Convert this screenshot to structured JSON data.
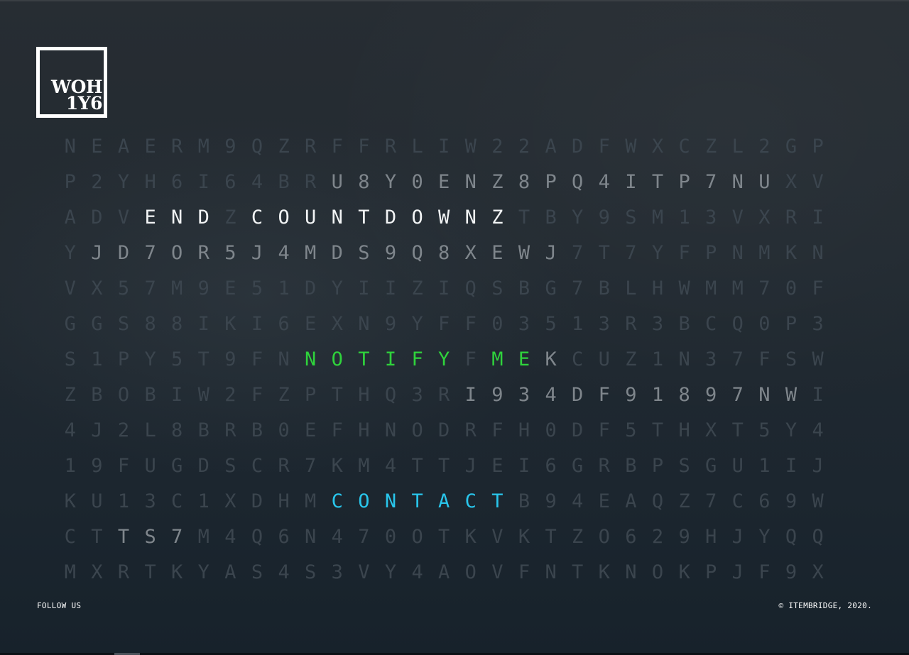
{
  "logo": {
    "line1": "WOH",
    "line2": "1Y6"
  },
  "grid_rows": [
    {
      "text": "NEAERM9QZRFFRLIW22ADFWXCZL2GP",
      "styles": "ddddddddddddddddddddddddddddd"
    },
    {
      "text": "P2YH6I64BRU8Y0ENZ8PQ4ITP7NUXV",
      "styles": "ddddddddddmmmmmmmmmmmmmmmmmdd"
    },
    {
      "text": "ADVENDZCOUNTDOWNZTBY9SM13VXRI",
      "styles": "dddtttdttttttttttdddddddddddd"
    },
    {
      "text": "YJD7OR5J4MDS9Q8XEWJ7T7YFPNMKN",
      "styles": "dmmmmmmmmmmmmmmmmmmdddddddddd"
    },
    {
      "text": "VX57M9E51DYIIZIQSBG7BLHWMM70F",
      "styles": "ddddddddddddddddddddddddddddd"
    },
    {
      "text": "GGS88IKI6EXN9YFF0351 3R3BCQ0P3",
      "styles": "ddddddddddddddddddddddddddddd"
    },
    {
      "text": "S1PY5T9FNNOTIFYFMEKCUZ1N37FSW",
      "styles": "dddddddddnnnnnndnnmdddddddddd"
    },
    {
      "text": "ZBOBIW2FZPTHQ3RI934DF91897NWI",
      "styles": "dddddddddddddddmmmmmmmmmmmmmd"
    },
    {
      "text": "4J2L8BRB0EFHNODRFH0DF5THXT5Y4",
      "styles": "ddddddddddddddddddddddddddddd"
    },
    {
      "text": "19FUGDSCR7KM4TTJEI6GRBPSGU1IJ",
      "styles": "ddddddddddddddddddddddddddddd"
    },
    {
      "text": "KU13C1XDHMCONTACTB94EAQZ7C69W",
      "styles": "ddddddddddcccccccdddddddddddd"
    },
    {
      "text": "CTTS7M4Q6N470OTKVKTZO629HJYQQ",
      "styles": "ddmmmdddddddddddddddddddddddd"
    },
    {
      "text": "MXRTKYAS4S3VY4AOVFNTKNOKPJF9X",
      "styles": "ddddddddddddddddddddddddddddd"
    }
  ],
  "colors": {
    "dim": "#3b454e",
    "mid": "#7f868c",
    "title": "#f2f4f5",
    "notify": "#2fd33c",
    "contact": "#29c6ec"
  },
  "footer": {
    "follow_label": "FOLLOW US",
    "copyright": "© ITEMBRIDGE, 2020."
  }
}
